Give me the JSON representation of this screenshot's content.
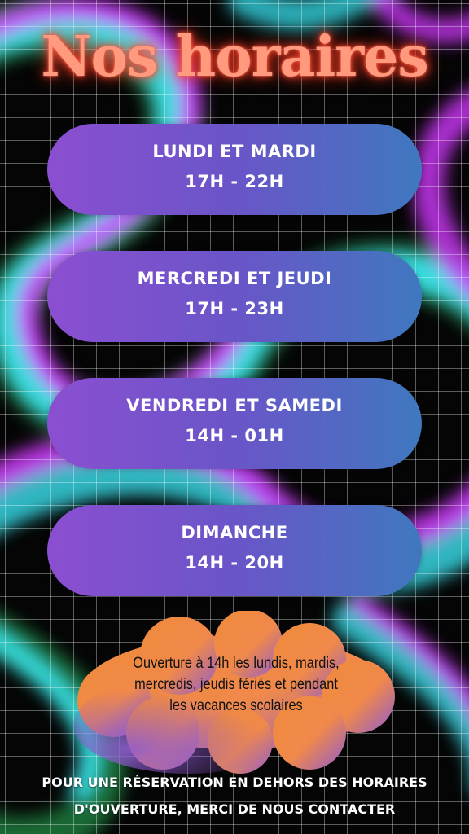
{
  "title": "Nos horaires",
  "schedule": [
    {
      "days": "LUNDI ET MARDI",
      "hours": "17H - 22H"
    },
    {
      "days": "MERCREDI ET JEUDI",
      "hours": "17H - 23H"
    },
    {
      "days": "VENDREDI ET SAMEDI",
      "hours": "14H - 01H"
    },
    {
      "days": "DIMANCHE",
      "hours": "14H - 20H"
    }
  ],
  "note": {
    "line1": "Ouverture à 14h les lundis, mardis,",
    "line2": "mercredis, jeudis fériés et pendant",
    "line3": "les vacances scolaires"
  },
  "footer": {
    "line1": "POUR UNE RÉSERVATION EN DEHORS DES HORAIRES",
    "line2": "D'OUVERTURE, MERCI DE NOUS CONTACTER"
  },
  "colors": {
    "title": "#ff9a7e",
    "pill_start": "#8b4fd1",
    "pill_end": "#3f78bf",
    "cloud_orange": "#f08a3c",
    "cloud_purple": "#8f5bd0",
    "swirl_magenta": "#d238ff",
    "swirl_cyan": "#3df2ff",
    "swirl_green": "#3aff7a"
  }
}
